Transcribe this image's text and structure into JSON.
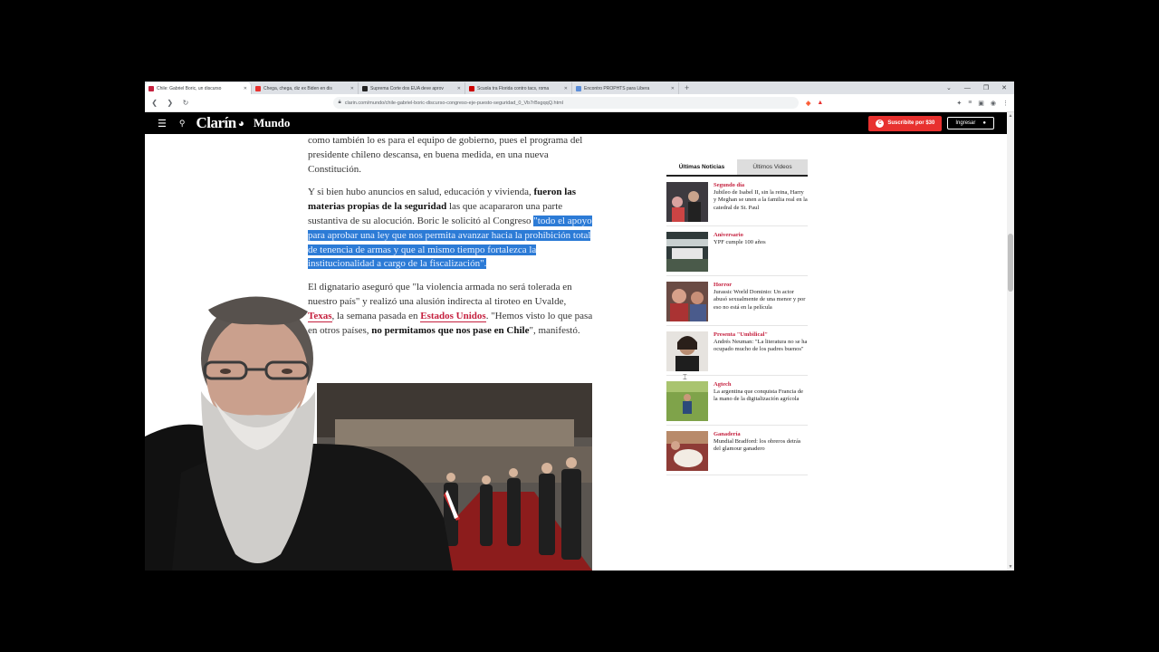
{
  "browser": {
    "tabs": [
      {
        "label": "Chile: Gabriel Boric, un discurso",
        "color": "#c5203e"
      },
      {
        "label": "Chega, chega, diz ex Biden en dis",
        "color": "#e8312f"
      },
      {
        "label": "Suprema Corte dos EUA deve aprov",
        "color": "#222222"
      },
      {
        "label": "Scuola tra Florida contro tacs, roma",
        "color": "#cc0000"
      },
      {
        "label": "Encontro PROPHTS para Libera",
        "color": "#5b8dd9"
      }
    ],
    "url": "clarin.com/mundo/chile-gabriel-boric-discurso-congreso-eje-puesto-seguridad_0_Vb7rBsgqqQ.html"
  },
  "site": {
    "logo": "Clarín",
    "section": "Mundo",
    "subscribe_label": "Suscribite por $30",
    "login_label": "Ingresar"
  },
  "article": {
    "p1": "como también lo es para el equipo de gobierno, pues el programa del presidente chileno descansa, en buena medida, en una nueva Constitución.",
    "p2_a": "Y si bien hubo anuncios en salud, educación y vivienda,",
    "p2_bold": "fueron las materias propias de la seguridad",
    "p2_b": "las que acapararon una parte sustantiva de su alocución. Boric le solicitó al Congreso",
    "p2_highlight": "\"todo el apoyo para aprobar una ley que nos permita avanzar hacia la prohibición total de tenencia de armas y que al mismo tiempo fortalezca la institucionalidad a cargo de la fiscalización\".",
    "p3_a": "El dignatario aseguró que \"la violencia armada no será tolerada en nuestro país\" y realizó una alusión indirecta al tiroteo en Uvalde,",
    "p3_link1": "Texas",
    "p3_b": ", la semana pasada en",
    "p3_link2": "Estados Unidos",
    "p3_c": ". \"Hemos visto lo que pasa en otros países,",
    "p3_bold": "no permitamos que nos pase en Chile",
    "p3_d": "\", manifestó."
  },
  "sidebar": {
    "tab_active": "Últimas Noticias",
    "tab_inactive": "Últimos Videos",
    "items": [
      {
        "kicker": "Segundo día",
        "text": "Jubileo de Isabel II, sin la reina, Harry y Meghan se unen a la familia real en la catedral de St. Paul"
      },
      {
        "kicker": "Aniversario",
        "text": "YPF cumple 100 años"
      },
      {
        "kicker": "Horror",
        "text": "Jurassic World Dominio: Un actor abusó sexualmente de una menor y por eso no está en la película"
      },
      {
        "kicker": "Presenta \"Umbilical\"",
        "text": "Andrés Neuman: \"La literatura no se ha ocupado mucho de los padres buenos\""
      },
      {
        "kicker": "Agtech",
        "text": "La argentina que conquista Francia de la mano de la digitalización agrícola"
      },
      {
        "kicker": "Ganadería",
        "text": "Mundial Bradford: los obreros detrás del glamour ganadero"
      }
    ]
  },
  "colors": {
    "accent": "#c5203e",
    "highlight": "#2c7bd6",
    "header": "#000000",
    "subscribe": "#e8312f"
  }
}
